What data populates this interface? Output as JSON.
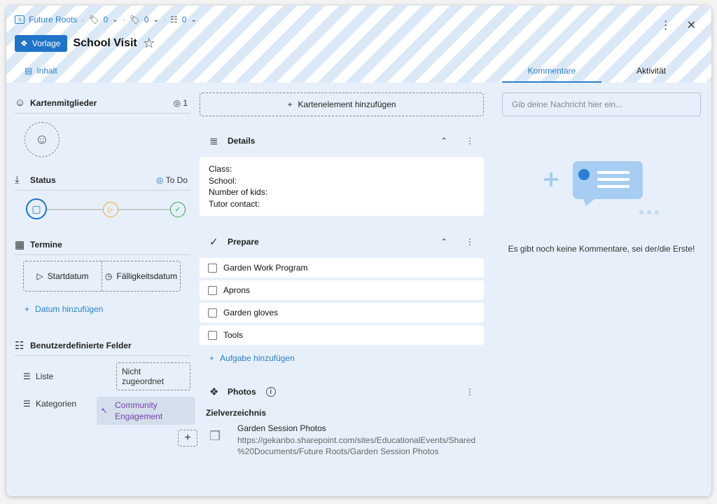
{
  "header": {
    "crumbs": {
      "project": "Future Roots",
      "count1": "0",
      "count2": "0",
      "count3": "0"
    },
    "template_label": "Vorlage",
    "title": "School Visit",
    "icons": [
      "star-icon",
      "more-vertical-icon",
      "close-icon"
    ]
  },
  "tabs": {
    "content": "Inhalt",
    "comments": "Kommentare",
    "activity": "Aktivität"
  },
  "left": {
    "members": {
      "title": "Kartenmitglieder",
      "count": "1"
    },
    "status": {
      "title": "Status",
      "value": "To Do",
      "steps": [
        "todo",
        "in-progress",
        "done"
      ],
      "current": "todo"
    },
    "dates": {
      "title": "Termine",
      "start": "Startdatum",
      "due": "Fälligkeitsdatum",
      "add": "Datum hinzufügen"
    },
    "custom": {
      "title": "Benutzerdefinierte Felder",
      "list_label": "Liste",
      "list_value": "Nicht zugeordnet",
      "categories_label": "Kategorien",
      "category_line1": "Community",
      "category_line2": "Engagement"
    }
  },
  "middle": {
    "add_element": "Kartenelement hinzufügen",
    "details": {
      "title": "Details",
      "lines": [
        "Class:",
        "School:",
        "Number of kids:",
        "Tutor contact:"
      ]
    },
    "prepare": {
      "title": "Prepare",
      "tasks": [
        "Garden Work Program",
        "Aprons",
        "Garden gloves",
        "Tools"
      ],
      "add_task": "Aufgabe hinzufügen"
    },
    "photos": {
      "title": "Photos",
      "target_label": "Zielverzeichnis",
      "folder_name": "Garden Session Photos",
      "url_line1": "https://gekanbo.sharepoint.com/sites/EducationalEvents/Shared",
      "url_line2": "%20Documents/Future Roots/Garden Session Photos"
    }
  },
  "right": {
    "input_placeholder": "Gib deine Nachricht hier ein...",
    "empty_message": "Es gibt noch keine Kommentare, sei der/die Erste!"
  },
  "colors": {
    "accent": "#1f73c9",
    "link": "#2a7fd4",
    "panel_bg": "#e7f0fa",
    "status_in_progress": "#f5a32a",
    "status_done": "#36a24b",
    "category_text": "#7a3fb3"
  }
}
